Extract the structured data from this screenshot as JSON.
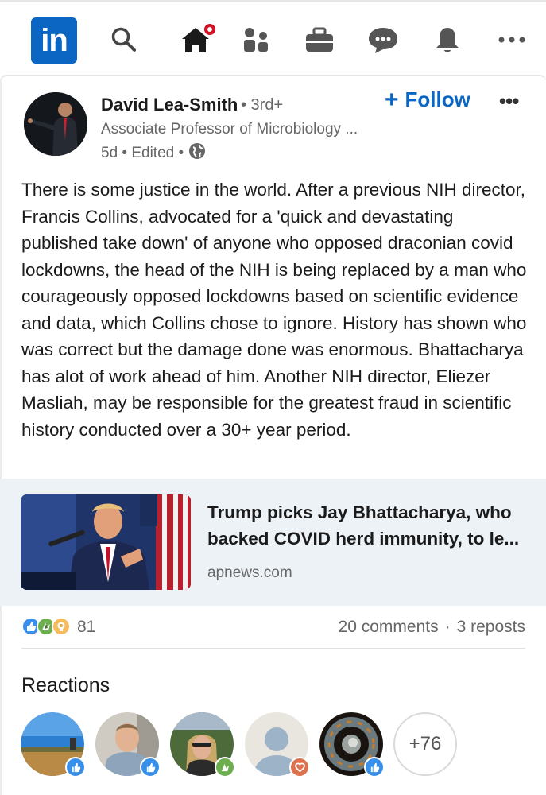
{
  "nav": {
    "logo_text": "in",
    "items": [
      {
        "icon": "search-icon"
      },
      {
        "icon": "home-icon",
        "has_notification": true
      },
      {
        "icon": "my-network-icon"
      },
      {
        "icon": "jobs-icon"
      },
      {
        "icon": "messaging-icon"
      },
      {
        "icon": "notifications-icon"
      },
      {
        "icon": "more-icon"
      }
    ]
  },
  "post": {
    "author": {
      "name": "David Lea-Smith",
      "degree": "• 3rd+",
      "headline": "Associate Professor of Microbiology ...",
      "meta": "5d • Edited •",
      "meta_icon": "globe-icon"
    },
    "follow_label": "Follow",
    "more_label": "•••",
    "text": "There is some justice in the world. After a previous NIH director, Francis Collins, advocated for a 'quick and devastating published take down' of anyone who opposed draconian covid lockdowns, the head of the NIH is being replaced by a man who courageously opposed lockdowns based on scientific evidence and data, which Collins chose to ignore. History has shown who was correct but the damage done was enormous. Bhattacharya has alot of work ahead of him. Another NIH director, Eliezer Masliah, may be responsible for the greatest fraud in scientific history conducted over a 30+ year period.",
    "link": {
      "title": "Trump picks Jay Bhattacharya, who backed COVID herd immunity, to le...",
      "source": "apnews.com"
    },
    "social": {
      "reaction_count": "81",
      "comments": "20 comments",
      "separator": "·",
      "reposts": "3 reposts",
      "reaction_types": [
        "like",
        "celebrate",
        "insightful"
      ]
    }
  },
  "reactions": {
    "heading": "Reactions",
    "more_count": "+76",
    "reactors": [
      {
        "badge": "like"
      },
      {
        "badge": "like"
      },
      {
        "badge": "celebrate"
      },
      {
        "badge": "love"
      },
      {
        "badge": "like"
      }
    ]
  },
  "colors": {
    "brand": "#0a66c2",
    "like": "#378fe9",
    "celebrate": "#44712e",
    "insightful": "#e7a33e",
    "love": "#df704d",
    "notification": "#d11124"
  }
}
